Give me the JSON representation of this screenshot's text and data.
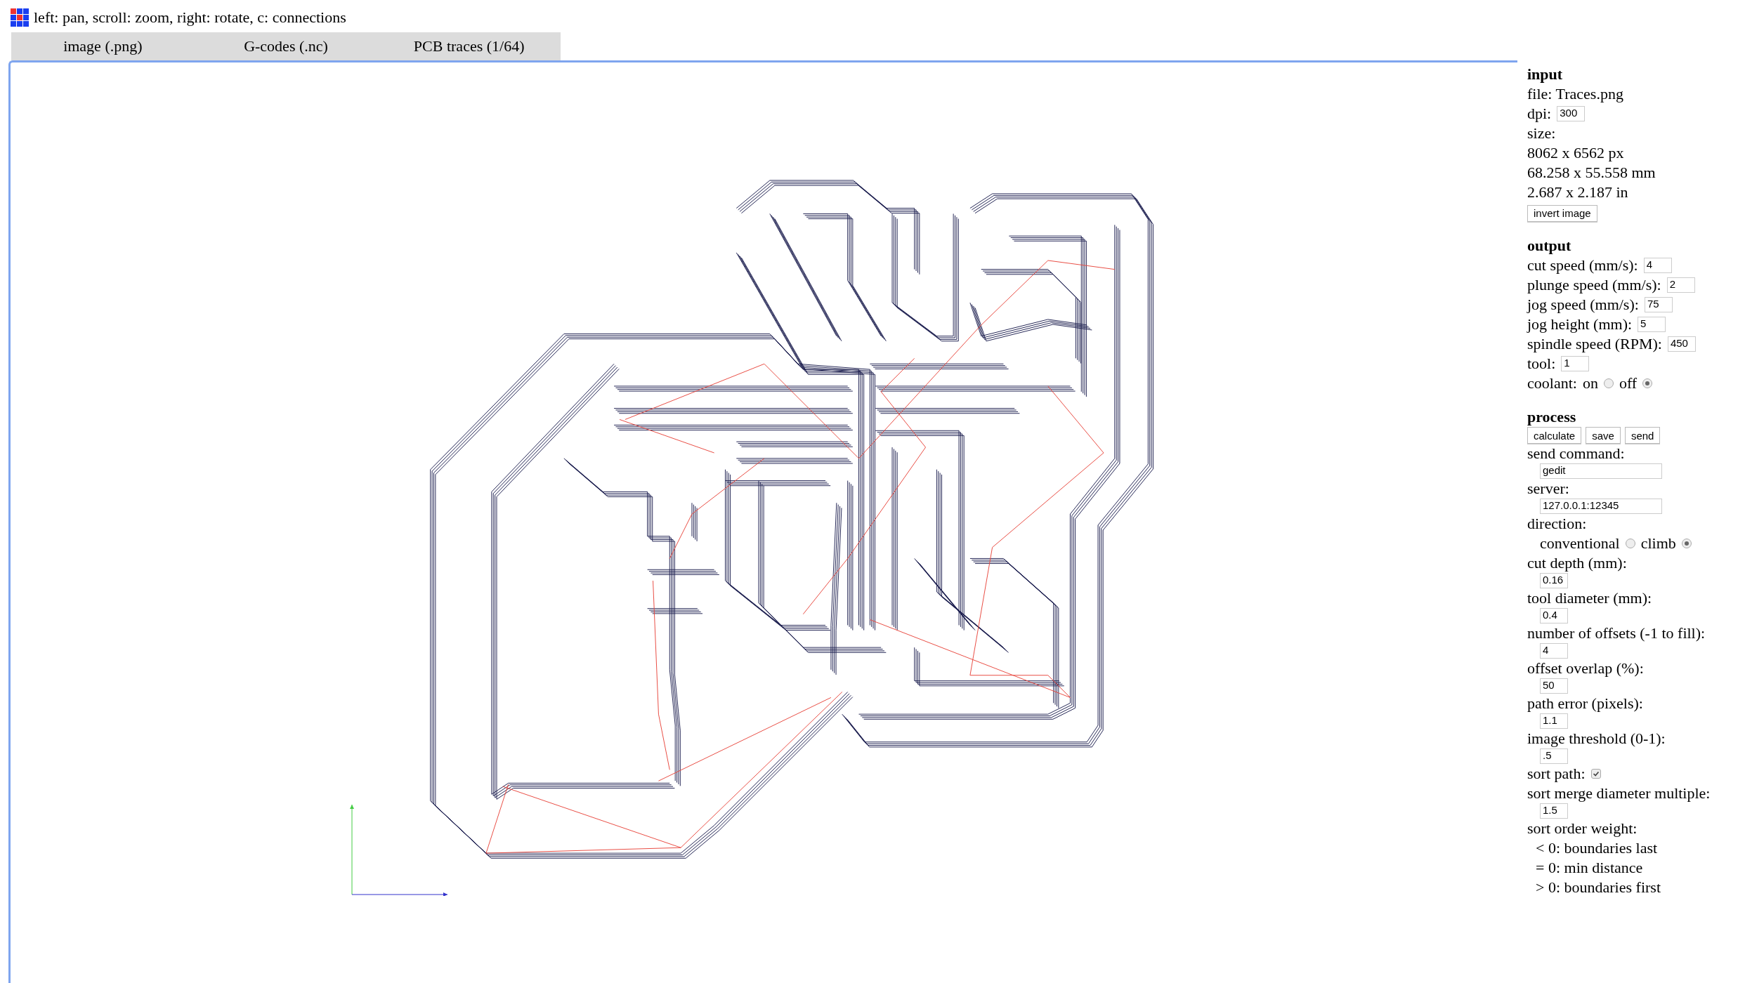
{
  "hint": "left: pan, scroll: zoom, right: rotate, c: connections",
  "tabs": [
    {
      "label": "image (.png)"
    },
    {
      "label": "G-codes (.nc)"
    },
    {
      "label": "PCB traces (1/64)"
    }
  ],
  "input": {
    "heading": "input",
    "file": "file: Traces.png",
    "dpi": {
      "label": "dpi:",
      "value": "300"
    },
    "size_label": "size:",
    "size_lines": [
      "8062 x 6562 px",
      "68.258 x 55.558 mm",
      "2.687 x 2.187 in"
    ],
    "button": "invert image"
  },
  "output": {
    "heading": "output",
    "fields": [
      {
        "label": "cut speed (mm/s):",
        "value": "4"
      },
      {
        "label": "plunge speed (mm/s):",
        "value": "2"
      },
      {
        "label": "jog speed (mm/s):",
        "value": "75"
      },
      {
        "label": "jog height (mm):",
        "value": "5"
      },
      {
        "label": "spindle speed (RPM):",
        "value": "450"
      },
      {
        "label": "tool:",
        "value": "1"
      }
    ],
    "coolant": {
      "label": "coolant:",
      "options": [
        {
          "label": "on",
          "selected": false
        },
        {
          "label": "off",
          "selected": true
        }
      ]
    }
  },
  "process": {
    "heading": "process",
    "buttons": [
      "calculate",
      "save",
      "send"
    ],
    "items": [
      {
        "kind": "wide_field",
        "label": "send command:",
        "value": "gedit"
      },
      {
        "kind": "wide_field",
        "label": "server:",
        "value": "127.0.0.1:12345"
      },
      {
        "kind": "radio",
        "label": "direction:",
        "options": [
          {
            "label": "conventional",
            "selected": false
          },
          {
            "label": "climb",
            "selected": true
          }
        ]
      },
      {
        "kind": "field",
        "label": "cut depth (mm):",
        "value": "0.16"
      },
      {
        "kind": "field",
        "label": "tool diameter (mm):",
        "value": "0.4"
      },
      {
        "kind": "field",
        "label": "number of offsets (-1 to fill):",
        "value": "4"
      },
      {
        "kind": "field",
        "label": "offset overlap (%):",
        "value": "50"
      },
      {
        "kind": "field",
        "label": "path error (pixels):",
        "value": "1.1"
      },
      {
        "kind": "field",
        "label": "image threshold (0-1):",
        "value": ".5"
      },
      {
        "kind": "checkbox",
        "label": "sort path:",
        "checked": true
      },
      {
        "kind": "field",
        "label": "sort merge diameter multiple:",
        "value": "1.5"
      },
      {
        "kind": "notes",
        "label": "sort order weight:",
        "lines": [
          "< 0: boundaries last",
          "= 0: min distance",
          "> 0: boundaries first"
        ]
      }
    ]
  }
}
